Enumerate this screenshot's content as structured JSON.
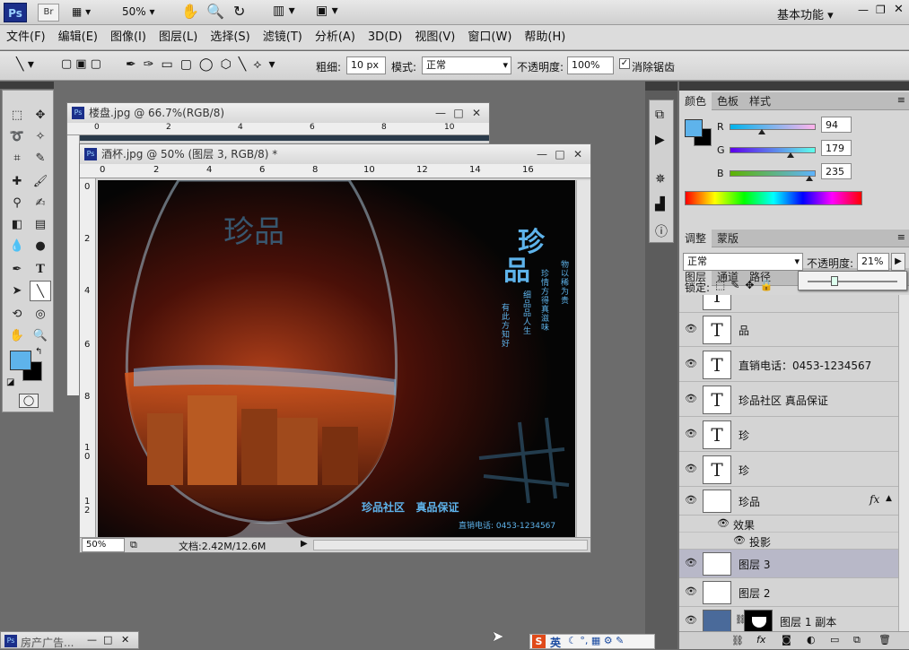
{
  "app": {
    "logo": "Ps",
    "bridge": "Br",
    "zoom": "50%",
    "workspace": "基本功能"
  },
  "menu": [
    "文件(F)",
    "编辑(E)",
    "图像(I)",
    "图层(L)",
    "选择(S)",
    "滤镜(T)",
    "分析(A)",
    "3D(D)",
    "视图(V)",
    "窗口(W)",
    "帮助(H)"
  ],
  "options": {
    "weight_label": "粗细:",
    "weight_value": "10 px",
    "mode_label": "模式:",
    "mode_value": "正常",
    "opacity_label": "不透明度:",
    "opacity_value": "100%",
    "antialias_label": "消除锯齿"
  },
  "doc_back": {
    "title": "楼盘.jpg @ 66.7%(RGB/8)",
    "ruler_ticks": [
      "0",
      "2",
      "4",
      "6",
      "8",
      "10"
    ]
  },
  "doc_front": {
    "title": "酒杯.jpg @ 50% (图层 3, RGB/8) *",
    "ruler_h": [
      "0",
      "2",
      "4",
      "6",
      "8",
      "10",
      "12",
      "14",
      "16"
    ],
    "ruler_v": [
      "0",
      "2",
      "4",
      "6",
      "8",
      "1\n0",
      "1\n2"
    ],
    "zoom": "50%",
    "docsize": "文档:2.42M/12.6M"
  },
  "art": {
    "title_char1": "珍",
    "title_char2": "品",
    "logo_text": "珍品",
    "poem_lines": [
      "有此方知好",
      "细品品人生",
      "珍情方得真滋味",
      "物以稀为贵"
    ],
    "slogan": "珍品社区   真品保证",
    "phone": "直销电话: 0453-1234567"
  },
  "color_panel": {
    "tabs": [
      "颜色",
      "色板",
      "样式"
    ],
    "r_label": "R",
    "g_label": "G",
    "b_label": "B",
    "r": 94,
    "g": 179,
    "b": 235,
    "fg": "#5eb3eb"
  },
  "adjust_tabs": [
    "调整",
    "蒙版"
  ],
  "layers_panel": {
    "tabs": [
      "图层",
      "通道",
      "路径"
    ],
    "blend": "正常",
    "opacity_label": "不透明度:",
    "opacity": "21%",
    "lock_label": "锁定:",
    "popup_slider_fraction": 0.3,
    "layers": [
      {
        "kind": "text",
        "name": "品"
      },
      {
        "kind": "text",
        "name": "直销电话：0453-1234567"
      },
      {
        "kind": "text",
        "name": "珍品社区 真品保证"
      },
      {
        "kind": "text",
        "name": "珍"
      },
      {
        "kind": "text",
        "name": "珍"
      }
    ],
    "layer_fx_name": "珍品",
    "fx_badge": "fx",
    "effects_label": "效果",
    "effect_shadow": "投影",
    "layer3": "图层 3",
    "layer2": "图层 2",
    "layer1copy": "图层 1 副本"
  },
  "taskbar_doc": "房产广告...",
  "ime": {
    "s": "S",
    "lang": "英"
  }
}
